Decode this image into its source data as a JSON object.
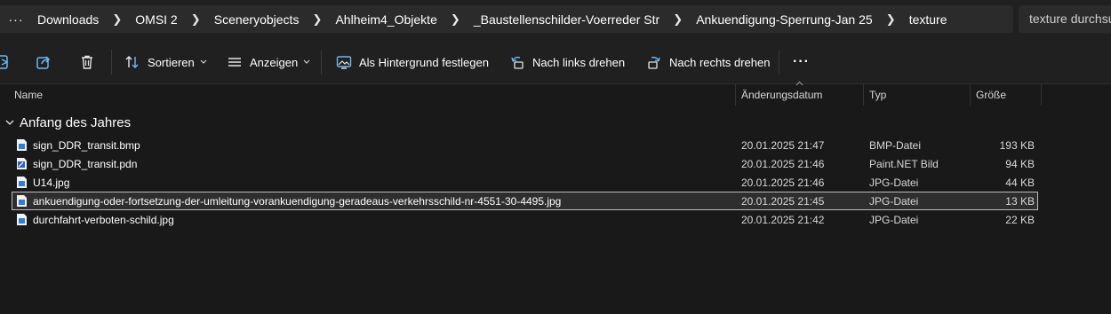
{
  "breadcrumb": {
    "more": "···",
    "items": [
      "Downloads",
      "OMSI 2",
      "Sceneryobjects",
      "Ahlheim4_Objekte",
      "_Baustellenschilder-Voerreder Str",
      "Ankuendigung-Sperrung-Jan 25",
      "texture"
    ]
  },
  "search": {
    "placeholder": "texture durchsuchen"
  },
  "toolbar": {
    "sort_label": "Sortieren",
    "view_label": "Anzeigen",
    "set_background_label": "Als Hintergrund festlegen",
    "rotate_left_label": "Nach links drehen",
    "rotate_right_label": "Nach rechts drehen",
    "more_label": "···"
  },
  "columns": {
    "name": "Name",
    "date": "Änderungsdatum",
    "type": "Typ",
    "size": "Größe"
  },
  "group": {
    "label": "Anfang des Jahres"
  },
  "files": [
    {
      "name": "sign_DDR_transit.bmp",
      "date": "20.01.2025 21:47",
      "type": "BMP-Datei",
      "size": "193 KB",
      "icon": "image-file-icon"
    },
    {
      "name": "sign_DDR_transit.pdn",
      "date": "20.01.2025 21:46",
      "type": "Paint.NET Bild",
      "size": "94 KB",
      "icon": "paintnet-file-icon"
    },
    {
      "name": "U14.jpg",
      "date": "20.01.2025 21:46",
      "type": "JPG-Datei",
      "size": "44 KB",
      "icon": "image-file-icon"
    },
    {
      "name": "ankuendigung-oder-fortsetzung-der-umleitung-vorankuendigung-geradeaus-verkehrsschild-nr-4551-30-4495.jpg",
      "date": "20.01.2025 21:45",
      "type": "JPG-Datei",
      "size": "13 KB",
      "icon": "image-file-icon",
      "selected": true
    },
    {
      "name": "durchfahrt-verboten-schild.jpg",
      "date": "20.01.2025 21:42",
      "type": "JPG-Datei",
      "size": "22 KB",
      "icon": "image-file-icon"
    }
  ],
  "colors": {
    "background": "#191919",
    "toolbar": "#202020",
    "accent": "#4aa3f0",
    "selection_border": "#bdbdbd"
  }
}
